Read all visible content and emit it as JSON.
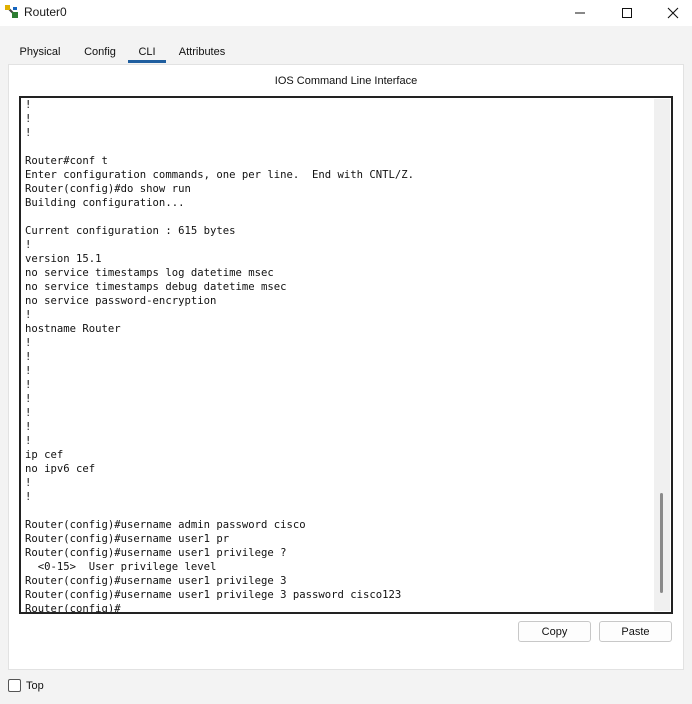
{
  "window": {
    "title": "Router0",
    "icon": "router-app-icon"
  },
  "tabs": [
    {
      "label": "Physical",
      "active": false
    },
    {
      "label": "Config",
      "active": false
    },
    {
      "label": "CLI",
      "active": true
    },
    {
      "label": "Attributes",
      "active": false
    }
  ],
  "panel": {
    "heading": "IOS Command Line Interface"
  },
  "terminal": {
    "lines": [
      "!",
      "!",
      "!",
      "",
      "Router#conf t",
      "Enter configuration commands, one per line.  End with CNTL/Z.",
      "Router(config)#do show run",
      "Building configuration...",
      "",
      "Current configuration : 615 bytes",
      "!",
      "version 15.1",
      "no service timestamps log datetime msec",
      "no service timestamps debug datetime msec",
      "no service password-encryption",
      "!",
      "hostname Router",
      "!",
      "!",
      "!",
      "!",
      "!",
      "!",
      "!",
      "!",
      "ip cef",
      "no ipv6 cef",
      "!",
      "!",
      "",
      "Router(config)#username admin password cisco",
      "Router(config)#username user1 pr",
      "Router(config)#username user1 privilege ?",
      "  <0-15>  User privilege level",
      "Router(config)#username user1 privilege 3",
      "Router(config)#username user1 privilege 3 password cisco123",
      "Router(config)#"
    ]
  },
  "buttons": {
    "copy": "Copy",
    "paste": "Paste"
  },
  "bottom": {
    "top_label": "Top",
    "top_checked": false
  }
}
